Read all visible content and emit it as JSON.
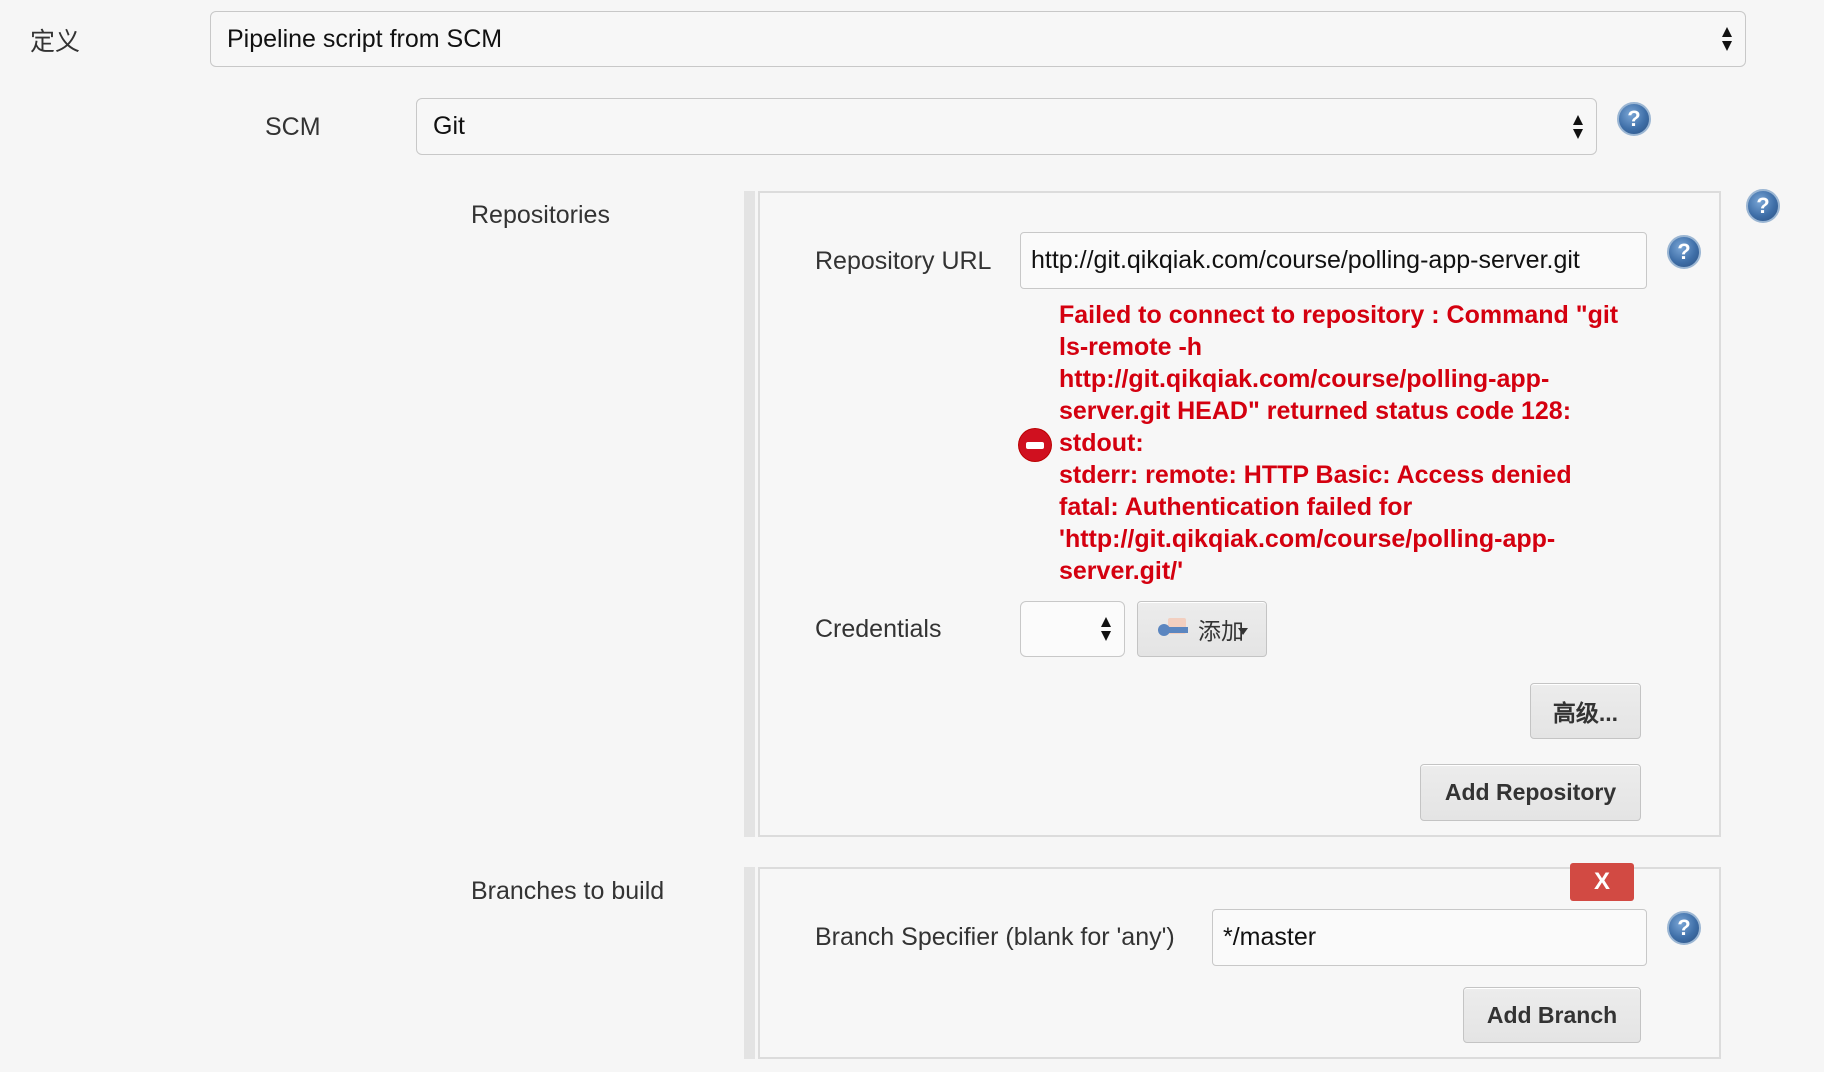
{
  "definition": {
    "label": "定义",
    "selected": "Pipeline script from SCM"
  },
  "scm": {
    "label": "SCM",
    "selected": "Git"
  },
  "repositories": {
    "label": "Repositories",
    "url_label": "Repository URL",
    "url_value": "http://git.qikqiak.com/course/polling-app-server.git",
    "error_lines": [
      "Failed to connect to repository : Command \"git",
      "ls-remote -h",
      "http://git.qikqiak.com/course/polling-app-",
      "server.git HEAD\" returned status code 128:",
      "stdout:",
      "stderr: remote: HTTP Basic: Access denied",
      "fatal: Authentication failed for",
      "'http://git.qikqiak.com/course/polling-app-",
      "server.git/'"
    ],
    "credentials_label": "Credentials",
    "credentials_selected": "",
    "add_credentials_label": "添加",
    "advanced_label": "高级...",
    "add_repository_label": "Add Repository"
  },
  "branches": {
    "label": "Branches to build",
    "delete_label": "X",
    "specifier_label": "Branch Specifier (blank for 'any')",
    "specifier_value": "*/master",
    "add_branch_label": "Add Branch"
  },
  "icons": {
    "help": "?",
    "error": "error-stop-icon",
    "select_arrows": "up-down-arrows",
    "credentials_key": "key-icon"
  },
  "colors": {
    "error": "#d4000f",
    "delete_button": "#d24a43",
    "help_icon": "#3f6fa8",
    "background": "#f6f6f6"
  }
}
